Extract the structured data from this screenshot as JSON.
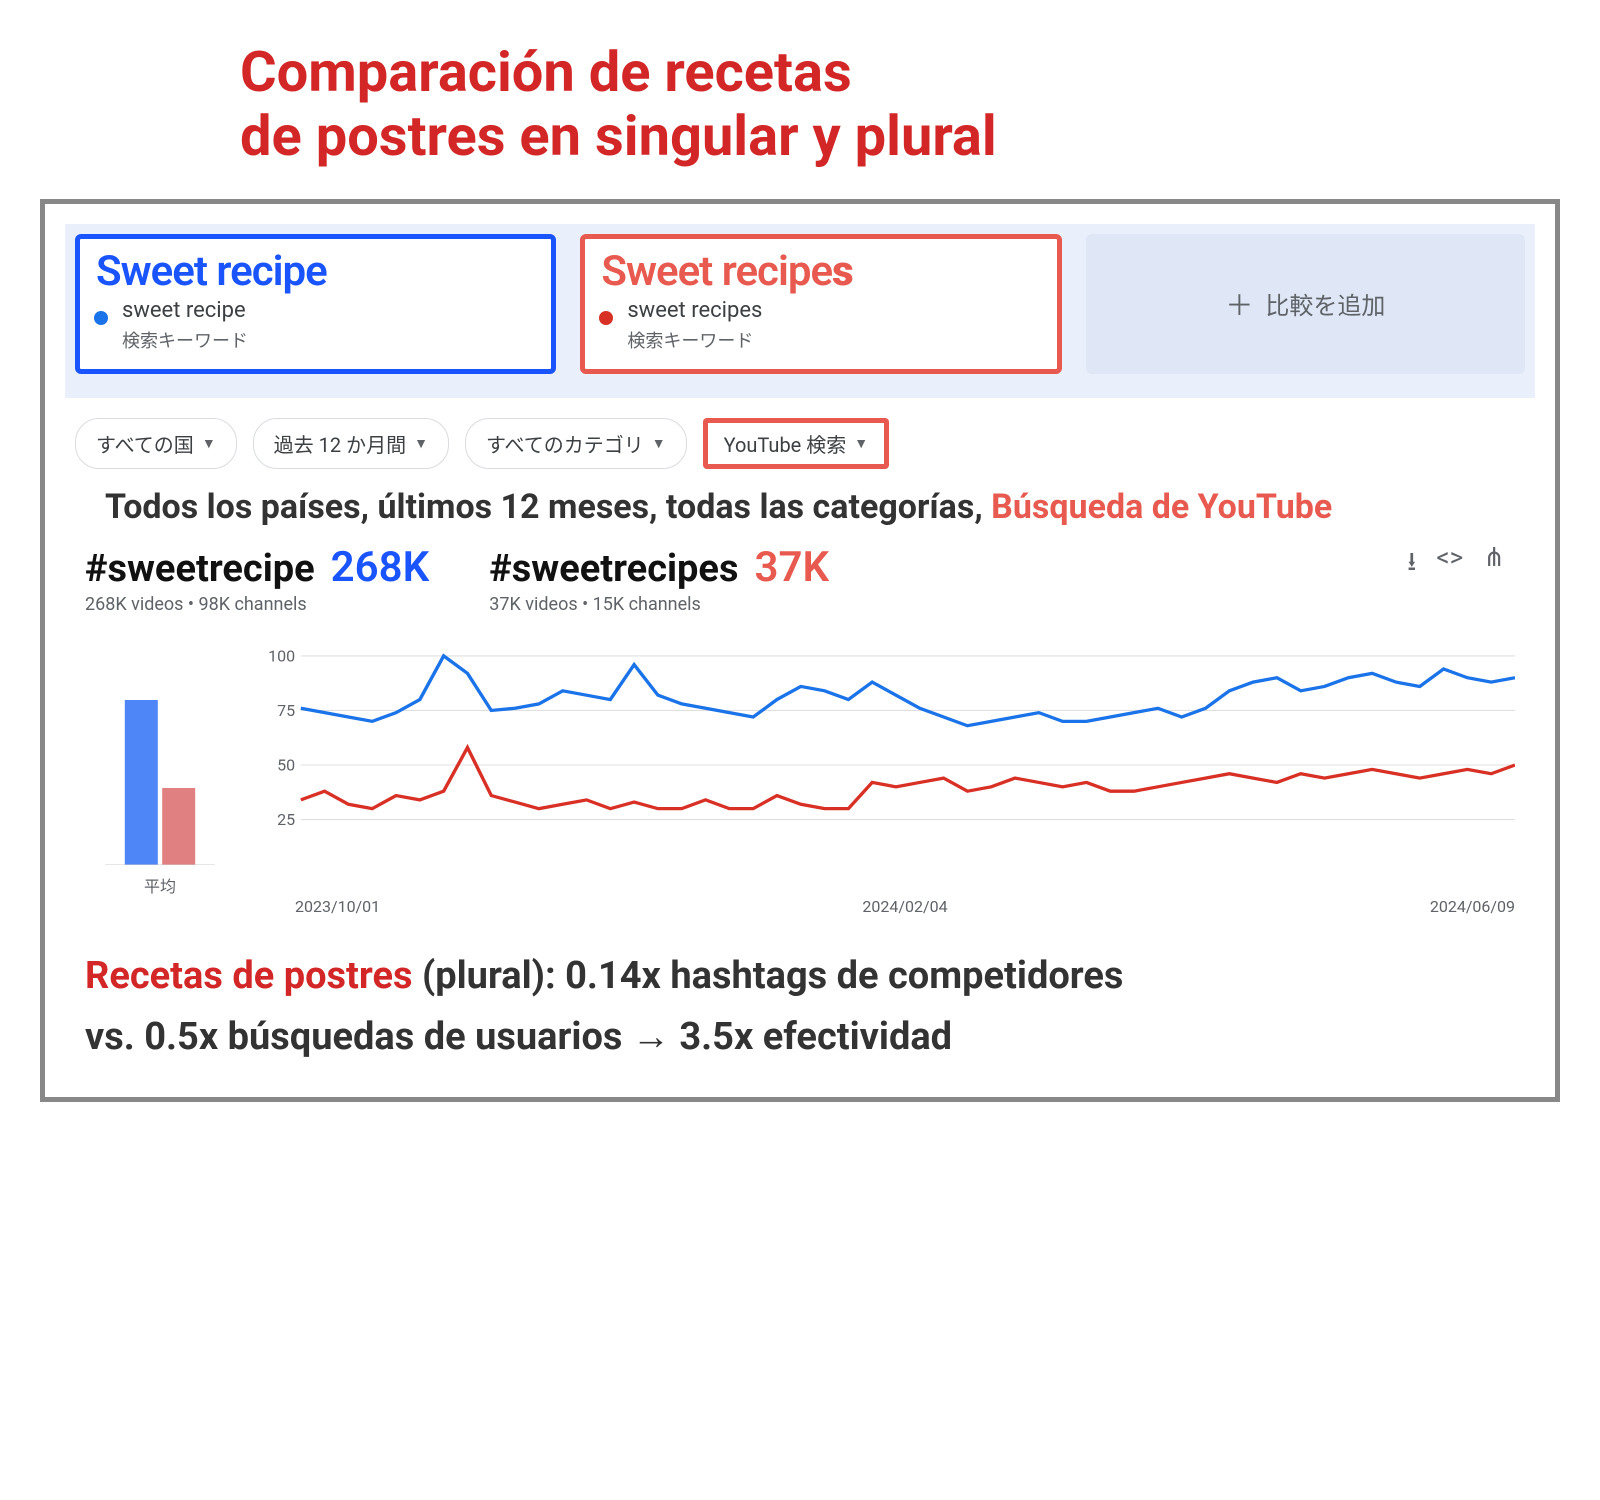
{
  "title_line1": "Comparación de recetas",
  "title_line2": "de postres en singular y plural",
  "cards": {
    "blue": {
      "annot": "Sweet recipe",
      "term": "sweet recipe",
      "type": "検索キーワード"
    },
    "red": {
      "annot_prefix": "Sweet recipe",
      "annot_suffix": "s",
      "term": "sweet recipes",
      "type": "検索キーワード"
    },
    "add_label": "比較を追加"
  },
  "filters": {
    "country": "すべての国",
    "period": "過去 12 か月間",
    "category": "すべてのカテゴリ",
    "search_type": "YouTube 検索"
  },
  "summary": {
    "prefix": "Todos los países, últimos 12 meses, todas las categorías, ",
    "highlight": "Búsqueda de YouTube"
  },
  "stats": {
    "a": {
      "tag": "#sweetrecipe",
      "value": "268K",
      "sub": "268K videos • 98K channels"
    },
    "b": {
      "tag": "#sweetrecipes",
      "value": "37K",
      "sub": "37K videos • 15K channels"
    }
  },
  "avg_label": "平均",
  "conclusion": {
    "hl": "Recetas de postres ",
    "rest1": "(plural): 0.14x hashtags de competidores",
    "rest2": "vs. 0.5x búsquedas de usuarios → 3.5x efectividad"
  },
  "chart_data": {
    "type": "line",
    "ylim": [
      0,
      100
    ],
    "yticks": [
      25,
      50,
      75,
      100
    ],
    "xticks": [
      "2023/10/01",
      "2024/02/04",
      "2024/06/09"
    ],
    "avg": {
      "blue": 80,
      "red": 40
    },
    "series": [
      {
        "name": "sweet recipe",
        "color": "#1a73e8",
        "values": [
          76,
          74,
          72,
          70,
          74,
          80,
          100,
          92,
          75,
          76,
          78,
          84,
          82,
          80,
          96,
          82,
          78,
          76,
          74,
          72,
          80,
          86,
          84,
          80,
          88,
          82,
          76,
          72,
          68,
          70,
          72,
          74,
          70,
          70,
          72,
          74,
          76,
          72,
          76,
          84,
          88,
          90,
          84,
          86,
          90,
          92,
          88,
          86,
          94,
          90,
          88,
          90
        ]
      },
      {
        "name": "sweet recipes",
        "color": "#d93025",
        "values": [
          34,
          38,
          32,
          30,
          36,
          34,
          38,
          58,
          36,
          33,
          30,
          32,
          34,
          30,
          33,
          30,
          30,
          34,
          30,
          30,
          36,
          32,
          30,
          30,
          42,
          40,
          42,
          44,
          38,
          40,
          44,
          42,
          40,
          42,
          38,
          38,
          40,
          42,
          44,
          46,
          44,
          42,
          46,
          44,
          46,
          48,
          46,
          44,
          46,
          48,
          46,
          50
        ]
      }
    ]
  }
}
